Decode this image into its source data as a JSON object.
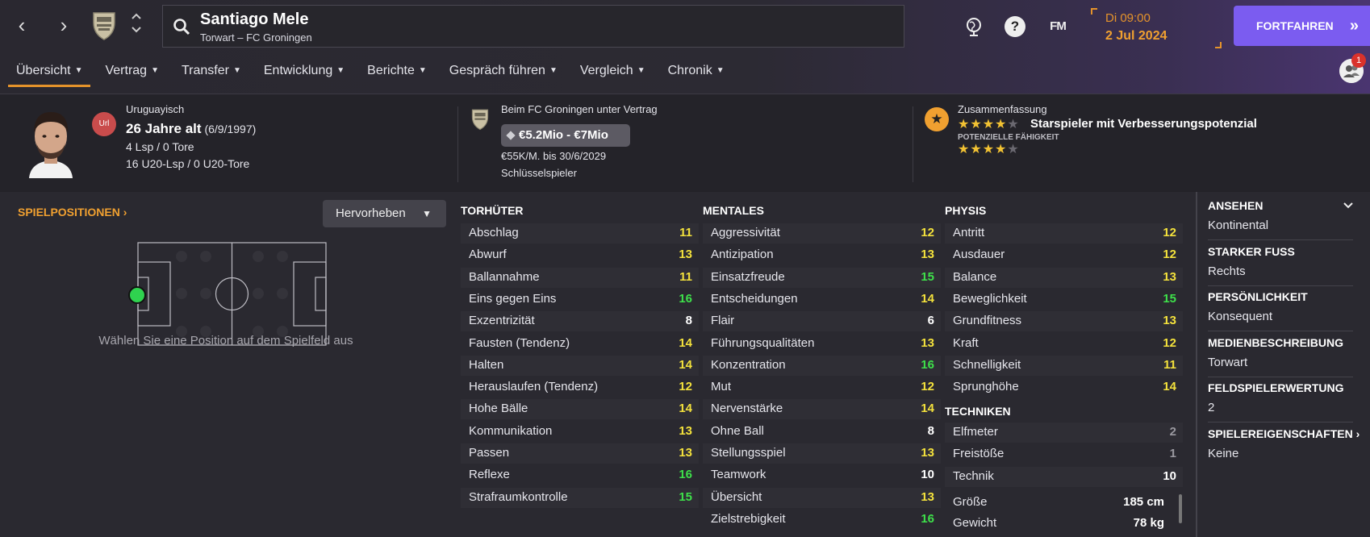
{
  "header": {
    "player_name": "Santiago Mele",
    "player_subtitle": "Torwart – FC Groningen",
    "fm_label": "FM",
    "date_day": "Di 09:00",
    "date_date": "2 Jul 2024",
    "continue_label": "FORTFAHREN",
    "continue_icon": "»",
    "notification_count": "1",
    "nav_back_icon": "‹",
    "nav_forward_icon": "›",
    "help_icon": "?"
  },
  "tabs": [
    {
      "label": "Übersicht"
    },
    {
      "label": "Vertrag"
    },
    {
      "label": "Transfer"
    },
    {
      "label": "Entwicklung"
    },
    {
      "label": "Berichte"
    },
    {
      "label": "Gespräch führen"
    },
    {
      "label": "Vergleich"
    },
    {
      "label": "Chronik"
    }
  ],
  "summary": {
    "flag_label": "Url",
    "nationality": "Uruguayisch",
    "age": "26 Jahre alt",
    "birthdate": "(6/9/1997)",
    "caps": "4 Lsp / 0 Tore",
    "u20_caps": "16 U20-Lsp / 0 U20-Tore",
    "contract": "Beim FC Groningen unter Vertrag",
    "value": "€5.2Mio - €7Mio",
    "wage": "€55K/M. bis 30/6/2029",
    "squad_status": "Schlüsselspieler",
    "summary_title": "Zusammenfassung",
    "current_stars": 4,
    "summary_text": "Starspieler mit Verbesserungspotenzial",
    "potential_label": "POTENZIELLE FÄHIGKEIT",
    "potential_stars": 4
  },
  "positions": {
    "title": "SPIELPOSITIONEN",
    "highlight_label": "Hervorheben",
    "hint": "Wählen Sie eine Position auf dem Spielfeld aus"
  },
  "goalkeeping": {
    "title": "TORHÜTER",
    "attributes": [
      {
        "name": "Abschlag",
        "value": "11"
      },
      {
        "name": "Abwurf",
        "value": "13"
      },
      {
        "name": "Ballannahme",
        "value": "11"
      },
      {
        "name": "Eins gegen Eins",
        "value": "16"
      },
      {
        "name": "Exzentrizität",
        "value": "8"
      },
      {
        "name": "Fausten (Tendenz)",
        "value": "14"
      },
      {
        "name": "Halten",
        "value": "14"
      },
      {
        "name": "Herauslaufen (Tendenz)",
        "value": "12"
      },
      {
        "name": "Hohe Bälle",
        "value": "14"
      },
      {
        "name": "Kommunikation",
        "value": "13"
      },
      {
        "name": "Passen",
        "value": "13"
      },
      {
        "name": "Reflexe",
        "value": "16"
      },
      {
        "name": "Strafraumkontrolle",
        "value": "15"
      }
    ]
  },
  "mental": {
    "title": "MENTALES",
    "attributes": [
      {
        "name": "Aggressivität",
        "value": "12"
      },
      {
        "name": "Antizipation",
        "value": "13"
      },
      {
        "name": "Einsatzfreude",
        "value": "15"
      },
      {
        "name": "Entscheidungen",
        "value": "14"
      },
      {
        "name": "Flair",
        "value": "6"
      },
      {
        "name": "Führungsqualitäten",
        "value": "13"
      },
      {
        "name": "Konzentration",
        "value": "16"
      },
      {
        "name": "Mut",
        "value": "12"
      },
      {
        "name": "Nervenstärke",
        "value": "14"
      },
      {
        "name": "Ohne Ball",
        "value": "8"
      },
      {
        "name": "Stellungsspiel",
        "value": "13"
      },
      {
        "name": "Teamwork",
        "value": "10"
      },
      {
        "name": "Übersicht",
        "value": "13"
      },
      {
        "name": "Zielstrebigkeit",
        "value": "16"
      }
    ]
  },
  "physical": {
    "title": "PHYSIS",
    "attributes": [
      {
        "name": "Antritt",
        "value": "12"
      },
      {
        "name": "Ausdauer",
        "value": "12"
      },
      {
        "name": "Balance",
        "value": "13"
      },
      {
        "name": "Beweglichkeit",
        "value": "15"
      },
      {
        "name": "Grundfitness",
        "value": "13"
      },
      {
        "name": "Kraft",
        "value": "12"
      },
      {
        "name": "Schnelligkeit",
        "value": "11"
      },
      {
        "name": "Sprunghöhe",
        "value": "14"
      }
    ]
  },
  "technical": {
    "title": "TECHNIKEN",
    "attributes": [
      {
        "name": "Elfmeter",
        "value": "2"
      },
      {
        "name": "Freistöße",
        "value": "1"
      },
      {
        "name": "Technik",
        "value": "10"
      }
    ]
  },
  "body": [
    {
      "name": "Größe",
      "value": "185 cm"
    },
    {
      "name": "Gewicht",
      "value": "78 kg"
    }
  ],
  "profile": [
    {
      "label": "ANSEHEN",
      "value": "Kontinental"
    },
    {
      "label": "STARKER FUSS",
      "value": "Rechts"
    },
    {
      "label": "PERSÖNLICHKEIT",
      "value": "Konsequent"
    },
    {
      "label": "MEDIENBESCHREIBUNG",
      "value": "Torwart"
    },
    {
      "label": "FELDSPIELERWERTUNG",
      "value": "2"
    },
    {
      "label": "SPIELEREIGENSCHAFTEN",
      "value": "Keine"
    }
  ],
  "colors": {
    "accent": "#f0a030",
    "continue": "#7b5cf0",
    "attr_green": "#3ee04a",
    "attr_yellow": "#f4e23c",
    "attr_white": "#ffffff",
    "attr_grey": "#9a99a0"
  }
}
